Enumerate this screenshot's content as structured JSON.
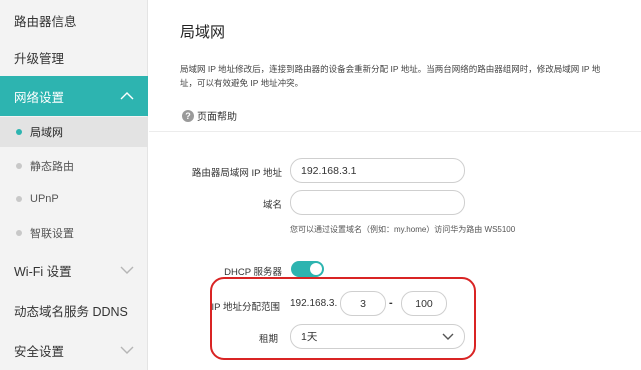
{
  "sidebar": {
    "items": [
      {
        "label": "路由器信息"
      },
      {
        "label": "升级管理"
      },
      {
        "label": "网络设置"
      },
      {
        "label": "Wi-Fi 设置"
      },
      {
        "label": "动态域名服务 DDNS"
      },
      {
        "label": "安全设置"
      }
    ],
    "subitems": [
      {
        "label": "局域网"
      },
      {
        "label": "静态路由"
      },
      {
        "label": "UPnP"
      },
      {
        "label": "智联设置"
      }
    ]
  },
  "main": {
    "title": "局域网",
    "description": "局域网 IP 地址修改后，连接到路由器的设备会重新分配 IP 地址。当两台网络的路由器组网时，修改局域网 IP 地址，可以有效避免 IP 地址冲突。",
    "help_label": "页面帮助",
    "help_icon": "?",
    "lan_ip_label": "路由器局域网 IP 地址",
    "lan_ip_value": "192.168.3.1",
    "domain_label": "域名",
    "domain_value": "",
    "domain_hint": "您可以通过设置域名（例如：my.home）访问华为路由 WS5100",
    "dhcp_label": "DHCP 服务器",
    "dhcp_enabled": true,
    "range_label": "IP 地址分配范围",
    "range_prefix": "192.168.3.",
    "range_start": "3",
    "range_sep": "-",
    "range_end": "100",
    "lease_label": "租期",
    "lease_value": "1天"
  },
  "colors": {
    "accent": "#2db4b0",
    "highlight": "#d92424"
  }
}
